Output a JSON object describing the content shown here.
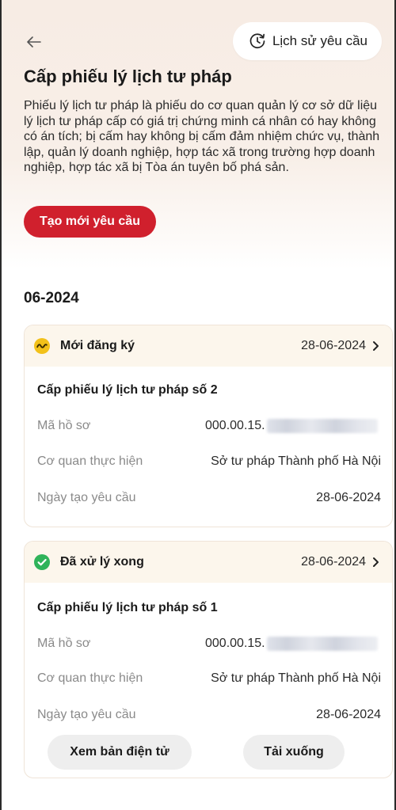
{
  "header": {
    "history_label": "Lịch sử yêu cầu"
  },
  "page": {
    "title": "Cấp phiếu lý lịch tư pháp",
    "description": "Phiếu lý lịch tư pháp là phiếu do cơ quan quản lý cơ sở dữ liệu lý lịch tư pháp cấp có giá trị chứng minh cá nhân có hay không có án tích; bị cấm hay không bị cấm đảm nhiệm chức vụ, thành lập, quản lý doanh nghiệp, hợp tác xã trong trường hợp doanh nghiệp, hợp tác xã bị Tòa án tuyên bố phá sản.",
    "create_label": "Tạo mới yêu cầu"
  },
  "month": "06-2024",
  "requests": [
    {
      "status": "Mới đăng ký",
      "date": "28-06-2024",
      "title": "Cấp phiếu lý lịch tư pháp số 2",
      "fields": {
        "ma_ho_so_label": "Mã hồ sơ",
        "ma_ho_so_value": "000.00.15.",
        "co_quan_label": "Cơ quan thực hiện",
        "co_quan_value": "Sở tư pháp Thành phố Hà Nội",
        "ngay_tao_label": "Ngày tạo yêu cầu",
        "ngay_tao_value": "28-06-2024"
      }
    },
    {
      "status": "Đã xử lý xong",
      "date": "28-06-2024",
      "title": "Cấp phiếu lý lịch tư pháp số 1",
      "fields": {
        "ma_ho_so_label": "Mã hồ sơ",
        "ma_ho_so_value": "000.00.15.",
        "co_quan_label": "Cơ quan thực hiện",
        "co_quan_value": "Sở tư pháp Thành phố Hà Nội",
        "ngay_tao_label": "Ngày tạo yêu cầu",
        "ngay_tao_value": "28-06-2024"
      },
      "actions": {
        "view_label": "Xem bản điện tử",
        "download_label": "Tải xuống"
      }
    }
  ],
  "icons": {
    "back": "arrow-left-icon",
    "history": "history-clock-icon",
    "pending": "pending-wave-icon",
    "done": "check-circle-icon",
    "chevron": "chevron-right-icon"
  },
  "colors": {
    "accent": "#d0202d",
    "pending": "#f2c11a",
    "done": "#2fb35a"
  }
}
